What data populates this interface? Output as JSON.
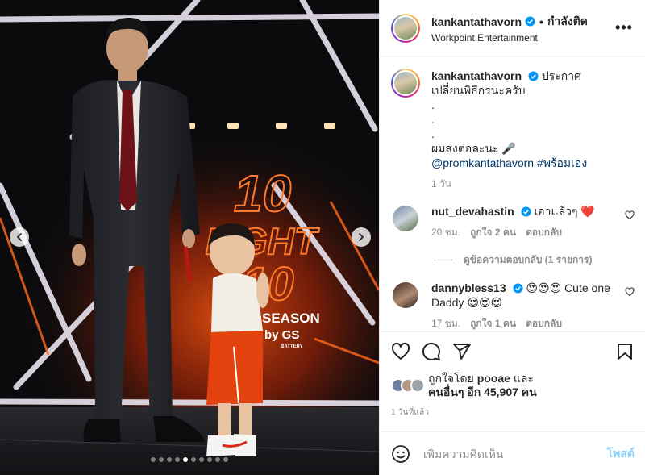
{
  "post": {
    "author": "kankantathavorn",
    "follow_separator": "•",
    "follow_label": "กำลังติด",
    "location": "Workpoint Entertainment",
    "more_label": "•••"
  },
  "media": {
    "dots_total": 10,
    "active_index": 4,
    "stage_sign_lines": [
      "10",
      "FIGHT",
      "10",
      "SEASON",
      "by GS",
      "BATTERY"
    ]
  },
  "caption": {
    "username": "kankantathavorn",
    "text_line1": "ประกาศ",
    "text_line2": "เปลี่ยนพิธีกรนะครับ",
    "dot_lines": [
      ".",
      ".",
      "."
    ],
    "text_line3": "ผมส่งต่อละนะ 🎤",
    "mention": "@promkantathavorn",
    "hashtag": "#พร้อมเอง",
    "time": "1 วัน"
  },
  "comments": [
    {
      "username": "nut_devahastin",
      "text": "เอาแล้วๆ ❤️",
      "time": "20 ชม.",
      "likes": "ถูกใจ 2 คน",
      "reply": "ตอบกลับ",
      "view_replies": "ดูข้อความตอบกลับ (1 รายการ)"
    },
    {
      "username": "dannybless13",
      "text": "😍😍😍 Cute one Daddy 😍😍😍",
      "time": "17 ชม.",
      "likes": "ถูกใจ 1 คน",
      "reply": "ตอบกลับ"
    }
  ],
  "likes": {
    "prefix": "ถูกใจโดย",
    "first_user": "pooae",
    "connector": "และ",
    "others": "คนอื่นๆ อีก 45,907 คน"
  },
  "posted_ago": "1 วันที่แล้ว",
  "add_comment": {
    "placeholder": "เพิ่มความคิดเห็น",
    "post_label": "โพสต์"
  },
  "colors": {
    "link": "#00376b",
    "verified": "#0095f6",
    "muted": "#8e8e8e",
    "stage_orange": "#ff6a1a"
  },
  "icons": [
    "verified-badge-icon",
    "heart-icon",
    "comment-icon",
    "share-icon",
    "bookmark-icon",
    "emoji-icon",
    "chevron-left-icon",
    "chevron-right-icon"
  ]
}
